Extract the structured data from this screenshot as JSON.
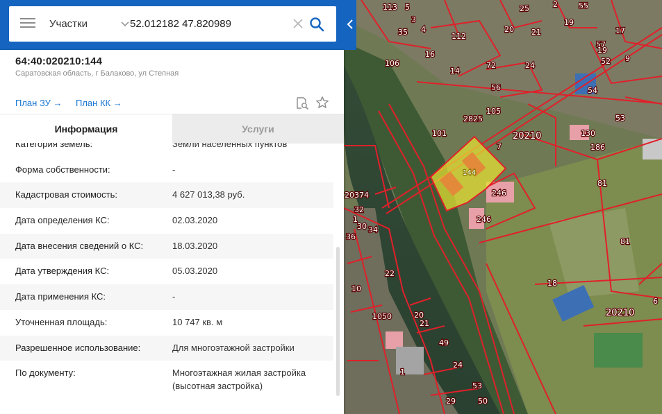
{
  "search": {
    "layer_label": "Участки",
    "query": "52.012182 47.820989"
  },
  "parcel": {
    "number": "64:40:020210:144",
    "address": "Саратовская область, г Балаково, ул Степная"
  },
  "links": {
    "plan_zu": "План ЗУ",
    "plan_kk": "План КК",
    "arrow": "→"
  },
  "tabs": {
    "info": "Информация",
    "services": "Услуги"
  },
  "info_rows": [
    {
      "label": "Категория земель:",
      "value": "Земли населенных пунктов"
    },
    {
      "label": "Форма собственности:",
      "value": "-"
    },
    {
      "label": "Кадастровая стоимость:",
      "value": "4 627 013,38 руб."
    },
    {
      "label": "Дата определения КС:",
      "value": "02.03.2020"
    },
    {
      "label": "Дата внесения сведений о КС:",
      "value": "18.03.2020"
    },
    {
      "label": "Дата утверждения КС:",
      "value": "05.03.2020"
    },
    {
      "label": "Дата применения КС:",
      "value": "-"
    },
    {
      "label": "Уточненная площадь:",
      "value": "10 747 кв. м"
    },
    {
      "label": "Разрешенное использование:",
      "value": "Для многоэтажной застройки"
    },
    {
      "label": "По документу:",
      "value": "Многоэтажная жилая застройка (высотная застройка)"
    }
  ],
  "map": {
    "highlighted_parcel": "144",
    "labels": [
      "113",
      "5",
      "25",
      "55",
      "35",
      "3",
      "4",
      "2",
      "112",
      "20",
      "21",
      "19",
      "17",
      "9",
      "106",
      "16",
      "14",
      "72",
      "24",
      "56",
      "57",
      "52",
      "19",
      "54",
      "2825",
      "105",
      "101",
      "20210",
      "7",
      "130",
      "186",
      "53",
      "246",
      "246",
      "81",
      "81",
      "20374",
      "32",
      "30",
      "34",
      "36",
      "1",
      "22",
      "18",
      "20210",
      "10",
      "1050",
      "20",
      "21",
      "49",
      "24",
      "1",
      "29",
      "53",
      "50",
      "6"
    ],
    "colors": {
      "boundary": "#e0202a",
      "highlight": "#e8e232",
      "topbar": "#1565c0",
      "link": "#1976d2"
    }
  }
}
